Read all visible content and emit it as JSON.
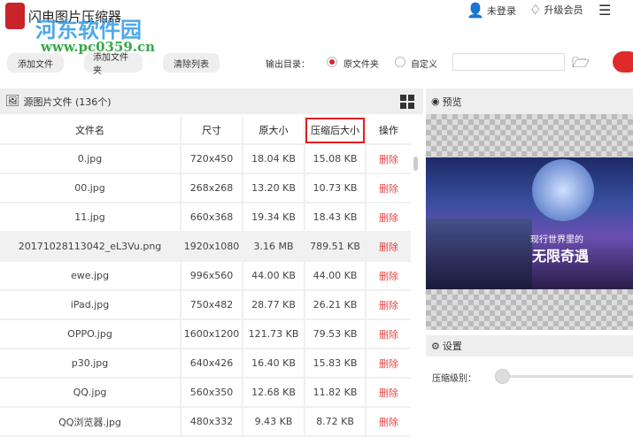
{
  "app": {
    "title": "闪电图片压缩器",
    "watermark": "河东软件园",
    "watermark_url": "www.pc0359.cn"
  },
  "topbar": {
    "login": "未登录",
    "upgrade": "升级会员"
  },
  "toolbar": {
    "add_file": "添加文件",
    "add_folder": "添加文件夹",
    "clear_list": "清除列表",
    "output_label": "输出目录：",
    "opt_original": "原文件夹",
    "opt_custom": "自定义",
    "path_value": ""
  },
  "left_panel": {
    "title": "源图片文件 (136个)"
  },
  "table": {
    "headers": [
      "文件名",
      "尺寸",
      "原大小",
      "压缩后大小",
      "操作"
    ],
    "rows": [
      [
        "0.jpg",
        "720x450",
        "18.04 KB",
        "15.08 KB",
        "删除"
      ],
      [
        "00.jpg",
        "268x268",
        "13.20 KB",
        "10.73 KB",
        "删除"
      ],
      [
        "11.jpg",
        "660x368",
        "19.34 KB",
        "18.43 KB",
        "删除"
      ],
      [
        "20171028113042_eL3Vu.png",
        "1920x1080",
        "3.16 MB",
        "789.51 KB",
        "删除"
      ],
      [
        "ewe.jpg",
        "996x560",
        "44.00 KB",
        "44.00 KB",
        "删除"
      ],
      [
        "iPad.jpg",
        "750x482",
        "28.77 KB",
        "26.21 KB",
        "删除"
      ],
      [
        "OPPO.jpg",
        "1600x1200",
        "121.73 KB",
        "79.53 KB",
        "删除"
      ],
      [
        "p30.jpg",
        "640x426",
        "16.40 KB",
        "15.83 KB",
        "删除"
      ],
      [
        "QQ.jpg",
        "560x350",
        "12.68 KB",
        "11.82 KB",
        "删除"
      ],
      [
        "QQ浏览器.jpg",
        "480x332",
        "9.43 KB",
        "8.72 KB",
        "删除"
      ]
    ]
  },
  "preview": {
    "title": "预览",
    "image_text1": "现行世界里的",
    "image_text2": "无限奇遇"
  },
  "settings": {
    "title": "设置",
    "level_label": "压缩级别：",
    "level_value": 0
  }
}
